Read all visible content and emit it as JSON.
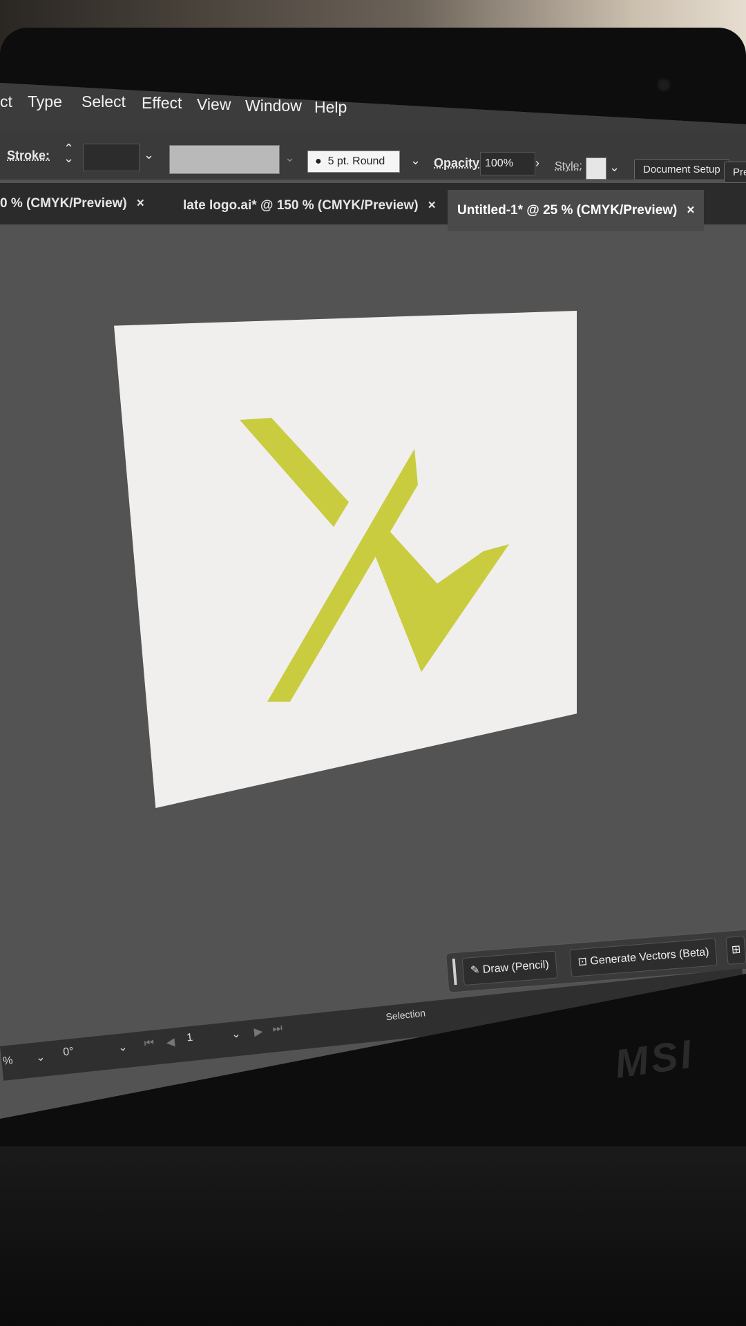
{
  "menu": [
    "ct",
    "Type",
    "Select",
    "Effect",
    "View",
    "Window",
    "Help"
  ],
  "control": {
    "stroke_label": "Stroke:",
    "brush_label": "5 pt. Round",
    "opacity_label": "Opacity:",
    "opacity_value": "100%",
    "style_label": "Style:",
    "document_setup": "Document Setup",
    "prefs_partial": "Pre"
  },
  "tabs": [
    {
      "label": "0 % (CMYK/Preview)",
      "close": "×"
    },
    {
      "label": "late logo.ai* @ 150 % (CMYK/Preview)",
      "close": "×"
    },
    {
      "label": "Untitled-1* @ 25 % (CMYK/Preview)",
      "close": "×"
    }
  ],
  "artboard": {
    "logo_color": "#c9cc3f",
    "background": "#f0efee"
  },
  "contextual_bar": {
    "draw_label": "Draw (Pencil)",
    "generate_label": "Generate Vectors (Beta)"
  },
  "status": {
    "zoom_partial": "%",
    "rotation": "0°",
    "artboard_number": "1",
    "tool": "Selection"
  },
  "brand": "MSI"
}
